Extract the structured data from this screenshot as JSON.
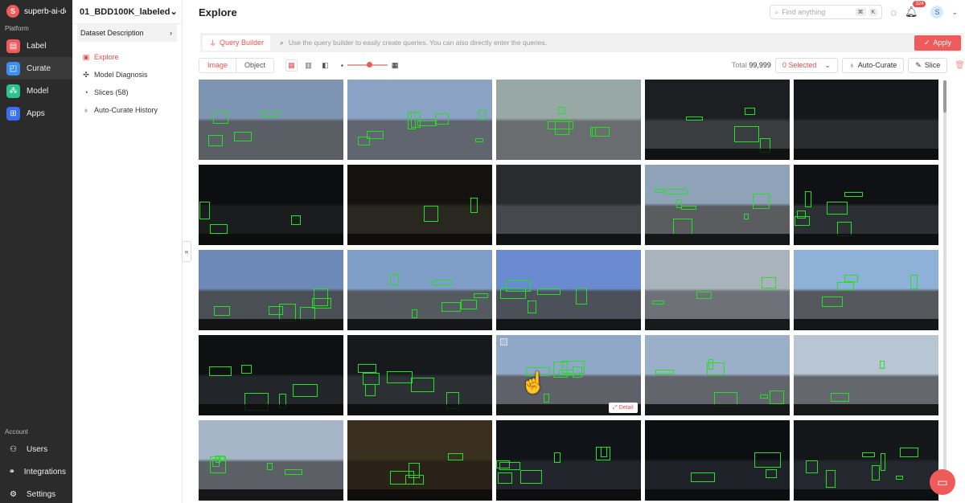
{
  "org": {
    "name": "superb-ai-demo",
    "logo_letter": "S"
  },
  "rail": {
    "platform_label": "Platform",
    "items": [
      {
        "label": "Label",
        "icon": "label-icon",
        "color": "#ef5b5b"
      },
      {
        "label": "Curate",
        "icon": "curate-icon",
        "color": "#3b8ef0"
      },
      {
        "label": "Model",
        "icon": "model-icon",
        "color": "#2cc28a"
      },
      {
        "label": "Apps",
        "icon": "apps-icon",
        "color": "#3b6ef0"
      }
    ],
    "account_label": "Account",
    "account_items": [
      {
        "label": "Users",
        "icon": "user-icon"
      },
      {
        "label": "Integrations",
        "icon": "link-icon"
      },
      {
        "label": "Settings",
        "icon": "gear-icon"
      }
    ]
  },
  "sidebar": {
    "dataset_name": "01_BDD100K_labeled",
    "dataset_description": "Dataset Description",
    "nav": [
      {
        "label": "Explore",
        "icon": "image-icon"
      },
      {
        "label": "Model Diagnosis",
        "icon": "diagnosis-icon"
      },
      {
        "label": "Slices (58)",
        "icon": "slices-icon"
      },
      {
        "label": "Auto-Curate History",
        "icon": "bulb-icon"
      }
    ]
  },
  "header": {
    "title": "Explore",
    "search_placeholder": "Find anything",
    "shortcut_keys": [
      "⌘",
      "K"
    ],
    "notification_count": "324",
    "avatar_letter": "S"
  },
  "query": {
    "builder_label": "Query Builder",
    "hint": "Use the query builder to easily create queries. You can also directly enter the queries.",
    "apply_label": "Apply"
  },
  "toolbar": {
    "tab_image": "Image",
    "tab_object": "Object",
    "total_label": "Total",
    "total_value": "99,999",
    "selected_label": "0 Selected",
    "auto_curate_label": "Auto-Curate",
    "slice_label": "Slice",
    "zoom_level": 0.55
  },
  "grid": {
    "detail_label": "Detail",
    "columns": 5,
    "tiles": [
      {
        "bg": "#7d95b3",
        "road": "#5a5f66",
        "boxes": 4,
        "dash": false
      },
      {
        "bg": "#8aa2c4",
        "road": "#606570",
        "boxes": 8,
        "dash": false
      },
      {
        "bg": "#98a8a4",
        "road": "#6a6d70",
        "boxes": 5,
        "dash": false
      },
      {
        "bg": "#1c1f22",
        "road": "#3a3d40",
        "boxes": 4,
        "dash": true
      },
      {
        "bg": "#15171a",
        "road": "#2a2c2e",
        "boxes": 0,
        "dash": true
      },
      {
        "bg": "#0d0e10",
        "road": "#1a1c1e",
        "boxes": 3,
        "dash": true
      },
      {
        "bg": "#14120e",
        "road": "#2a2620",
        "boxes": 2,
        "dash": true
      },
      {
        "bg": "#2a2c30",
        "road": "#45484c",
        "boxes": 0,
        "dash": true
      },
      {
        "bg": "#8fa3b8",
        "road": "#5a5c60",
        "boxes": 7,
        "dash": true
      },
      {
        "bg": "#0f1114",
        "road": "#2c2f33",
        "boxes": 6,
        "dash": true
      },
      {
        "bg": "#6d89b8",
        "road": "#4a4e55",
        "boxes": 6,
        "dash": true
      },
      {
        "bg": "#7f9fc8",
        "road": "#555a60",
        "boxes": 6,
        "dash": true
      },
      {
        "bg": "#6a8bd0",
        "road": "#4c5058",
        "boxes": 5,
        "dash": true
      },
      {
        "bg": "#a9b3bc",
        "road": "#6e7278",
        "boxes": 3,
        "dash": true
      },
      {
        "bg": "#8eb1d8",
        "road": "#54585d",
        "boxes": 4,
        "dash": true
      },
      {
        "bg": "#0e1012",
        "road": "#22252a",
        "boxes": 5,
        "dash": true
      },
      {
        "bg": "#16181c",
        "road": "#2c3035",
        "boxes": 6,
        "dash": true
      },
      {
        "bg": "#8fa8c8",
        "road": "#5e6268",
        "boxes": 6,
        "dash": true,
        "detail": true
      },
      {
        "bg": "#9ab0c8",
        "road": "#62666c",
        "boxes": 6,
        "dash": true
      },
      {
        "bg": "#b8c6d4",
        "road": "#64686e",
        "boxes": 2,
        "dash": true
      },
      {
        "bg": "#a6b6c8",
        "road": "#5c6066",
        "boxes": 6,
        "dash": true
      },
      {
        "bg": "#3a3020",
        "road": "#2a2218",
        "boxes": 4,
        "dash": true
      },
      {
        "bg": "#101418",
        "road": "#22262c",
        "boxes": 7,
        "dash": true
      },
      {
        "bg": "#0c0e12",
        "road": "#1e2228",
        "boxes": 3,
        "dash": true
      },
      {
        "bg": "#14161a",
        "road": "#24282e",
        "boxes": 7,
        "dash": true
      }
    ]
  }
}
